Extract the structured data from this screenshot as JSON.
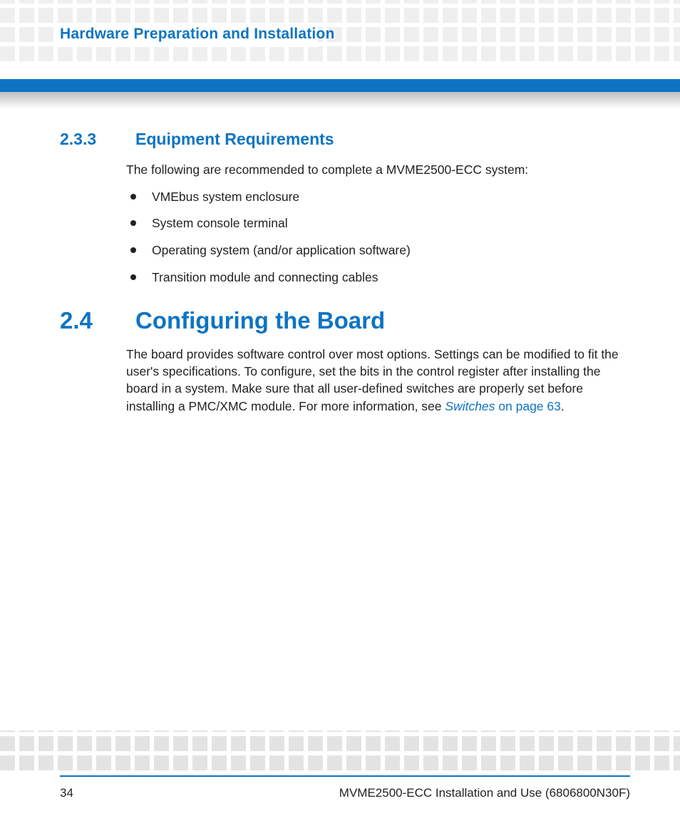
{
  "header": {
    "chapter_title": "Hardware Preparation and Installation"
  },
  "section_233": {
    "number": "2.3.3",
    "title": "Equipment Requirements",
    "intro": "The following are recommended to complete a MVME2500-ECC system:",
    "items": [
      "VMEbus system enclosure",
      "System console terminal",
      "Operating system (and/or application software)",
      "Transition module and connecting cables"
    ]
  },
  "section_24": {
    "number": "2.4",
    "title": "Configuring the Board",
    "body_before_link": "The board provides software control over most options. Settings can be modified to fit the user's specifications. To configure, set the bits in the control register after installing the board in a system. Make sure that all user-defined switches are properly set before installing a PMC/XMC module. For more information, see ",
    "link_italic": "Switches",
    "link_rest": " on page 63",
    "body_after_link": "."
  },
  "footer": {
    "page_number": "34",
    "doc_title": "MVME2500-ECC Installation and Use (6806800N30F)"
  }
}
